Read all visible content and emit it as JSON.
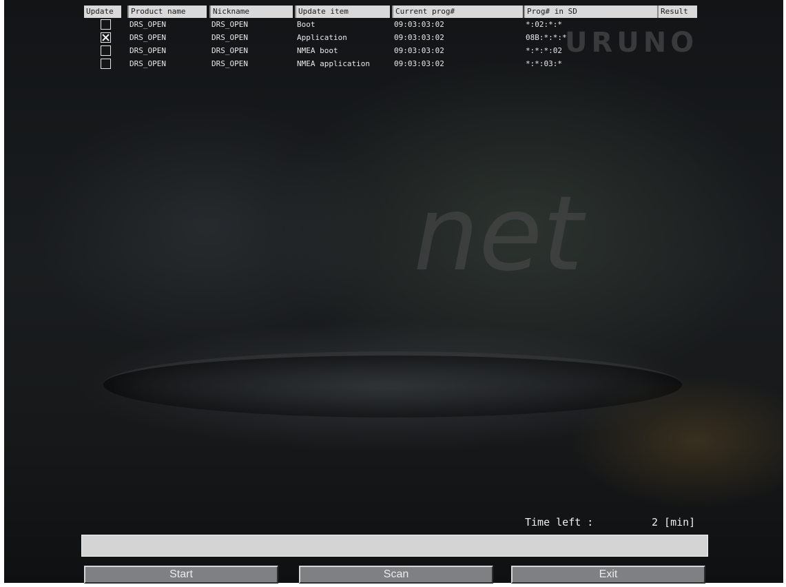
{
  "table": {
    "columns": [
      "Update",
      "Product name",
      "Nickname",
      "Update item",
      "Current prog#",
      "Prog# in SD",
      "Result"
    ],
    "rows": [
      {
        "checked": false,
        "product": "DRS_OPEN",
        "nickname": "DRS_OPEN",
        "item": "Boot",
        "current": "09:03:03:02",
        "sd": "*:02:*:*",
        "result": ""
      },
      {
        "checked": true,
        "product": "DRS_OPEN",
        "nickname": "DRS_OPEN",
        "item": "Application",
        "current": "09:03:03:02",
        "sd": "08B:*:*:*",
        "result": ""
      },
      {
        "checked": false,
        "product": "DRS_OPEN",
        "nickname": "DRS_OPEN",
        "item": "NMEA boot",
        "current": "09:03:03:02",
        "sd": "*:*:*:02",
        "result": ""
      },
      {
        "checked": false,
        "product": "DRS_OPEN",
        "nickname": "DRS_OPEN",
        "item": "NMEA application",
        "current": "09:03:03:02",
        "sd": "*:*:03:*",
        "result": ""
      }
    ]
  },
  "status": {
    "time_left_label": "Time left :",
    "time_left_value": "2 [min]",
    "progress_fraction": 0.0
  },
  "buttons": {
    "start": "Start",
    "scan": "Scan",
    "exit": "Exit"
  },
  "colors": {
    "header_bg": "#d9d9d9",
    "button_bg": "#7f8083",
    "progress_track": "#d4d4d4"
  },
  "icons": {
    "checkbox_checked": "x-mark-icon"
  }
}
